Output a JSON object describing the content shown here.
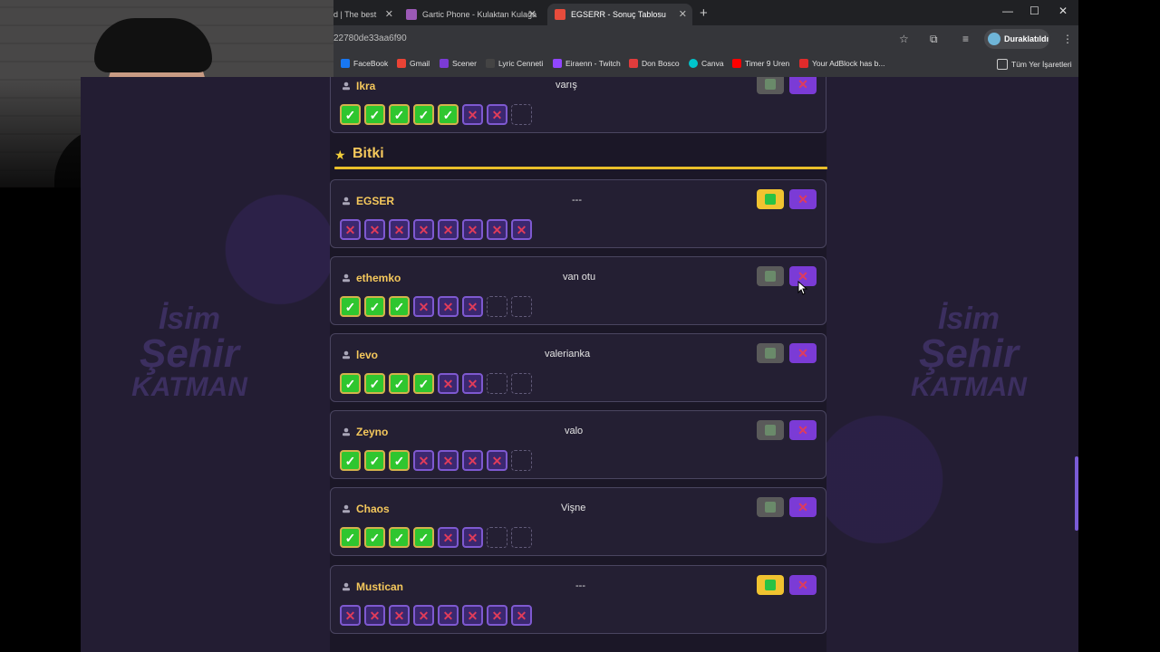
{
  "tabs": [
    {
      "label": "d | The best",
      "active": false
    },
    {
      "label": "Gartic Phone - Kulaktan Kulağa",
      "active": false
    },
    {
      "label": "EGSERR - Sonuç Tablosu",
      "active": true
    }
  ],
  "url": "22780de33aa6f90",
  "profile": {
    "label": "Duraklatıldı"
  },
  "bookmarks": [
    "FaceBook",
    "Gmail",
    "Scener",
    "Lyric Cenneti",
    "Eiraenn - Twitch",
    "Don Bosco",
    "Canva",
    "Timer 9 Uren",
    "Your AdBlock has b...",
    "Tüm Yer İşaretleri"
  ],
  "section_title": "Bitki",
  "logo": {
    "line1": "İsim",
    "line2": "Şehir",
    "line3": "KATMAN"
  },
  "colors": {
    "accent": "#f5c85c",
    "check": "#2fc62f",
    "cross": "#e03c5a",
    "purple": "#7b3bd6"
  },
  "players": [
    {
      "name": "Ikra",
      "answer": "varış",
      "approved": false,
      "boxes": [
        "ok",
        "ok",
        "ok",
        "ok",
        "ok",
        "no",
        "no",
        "empty"
      ]
    },
    {
      "name": "EGSER",
      "answer": "---",
      "approved": true,
      "boxes": [
        "no",
        "no",
        "no",
        "no",
        "no",
        "no",
        "no",
        "no"
      ]
    },
    {
      "name": "ethemko",
      "answer": "van otu",
      "approved": false,
      "boxes": [
        "ok",
        "ok",
        "ok",
        "no",
        "no",
        "no",
        "empty",
        "empty"
      ]
    },
    {
      "name": "levo",
      "answer": "valerianka",
      "approved": false,
      "boxes": [
        "ok",
        "ok",
        "ok",
        "ok",
        "no",
        "no",
        "empty",
        "empty"
      ]
    },
    {
      "name": "Zeyno",
      "answer": "valo",
      "approved": false,
      "boxes": [
        "ok",
        "ok",
        "ok",
        "no",
        "no",
        "no",
        "no",
        "empty"
      ]
    },
    {
      "name": "Chaos",
      "answer": "Vişne",
      "approved": false,
      "boxes": [
        "ok",
        "ok",
        "ok",
        "ok",
        "no",
        "no",
        "empty",
        "empty"
      ]
    },
    {
      "name": "Mustican",
      "answer": "---",
      "approved": true,
      "boxes": [
        "no",
        "no",
        "no",
        "no",
        "no",
        "no",
        "no",
        "no"
      ]
    }
  ]
}
